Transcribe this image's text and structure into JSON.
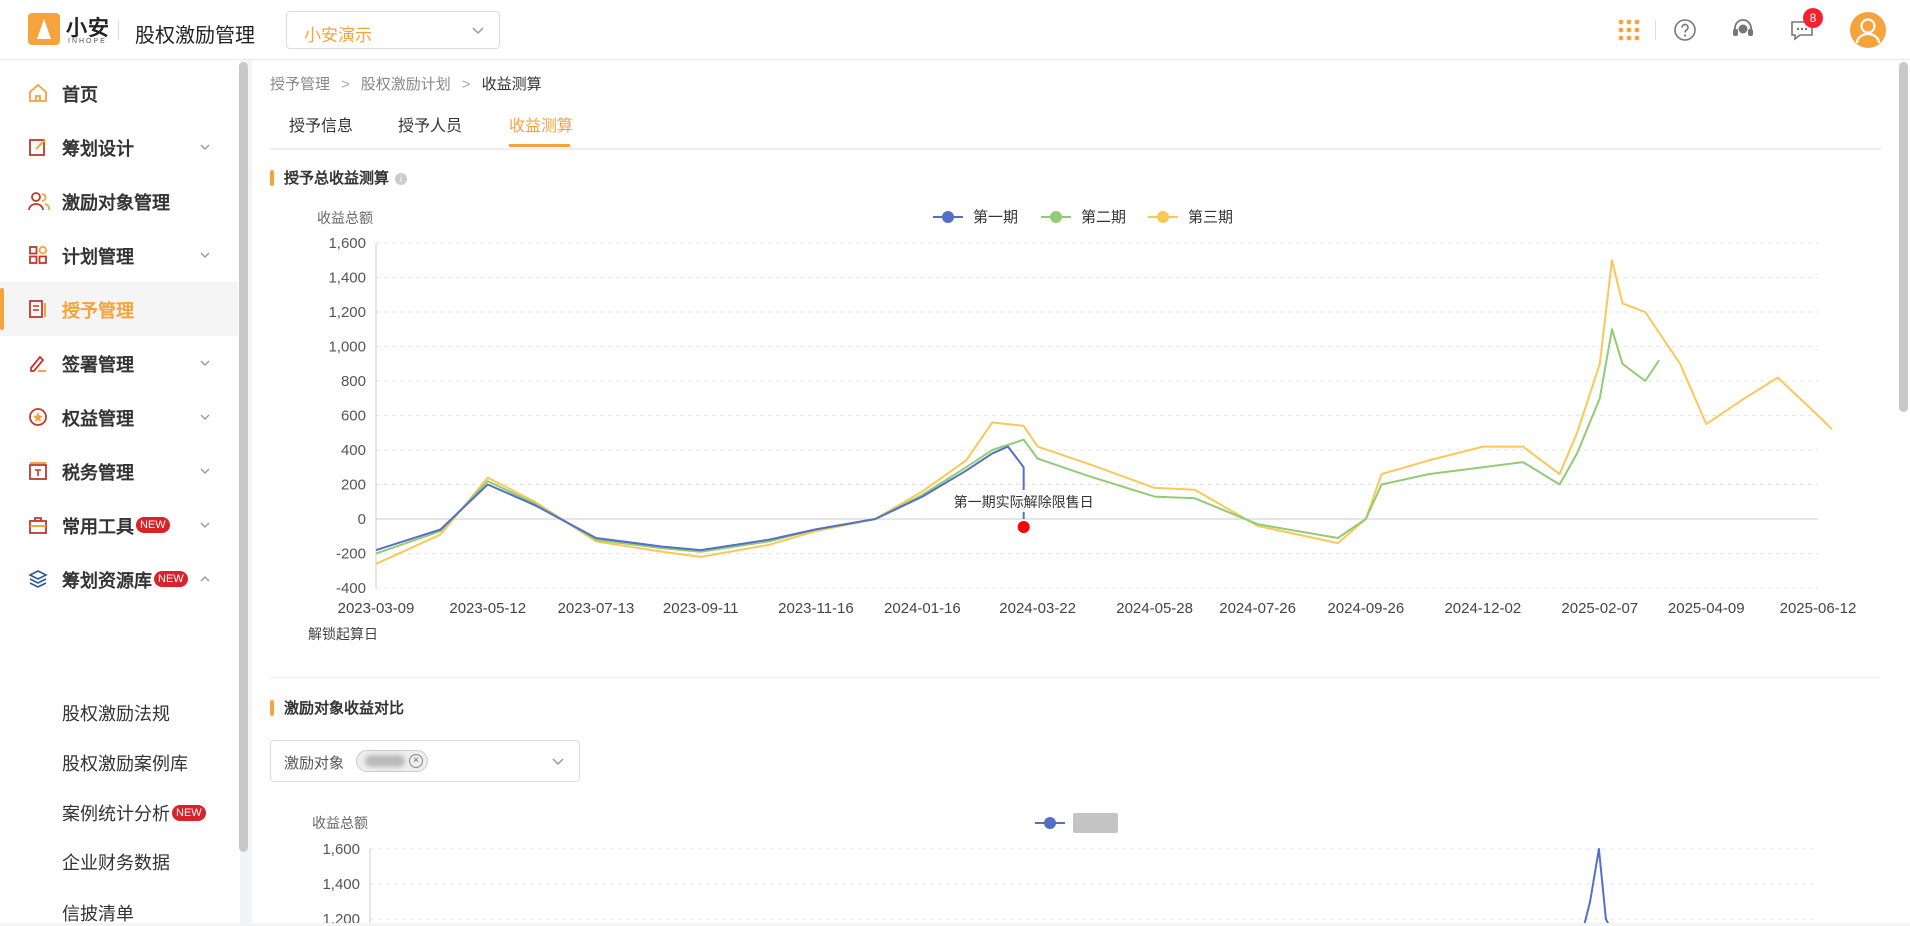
{
  "header": {
    "logo_text": "小安",
    "logo_sub": "INHOPE",
    "app_title": "股权激励管理",
    "company_select": "小安演示",
    "notification_count": "8"
  },
  "sidebar": {
    "items": [
      {
        "label": "首页",
        "icon": "home-icon"
      },
      {
        "label": "筹划设计",
        "icon": "edit-icon"
      },
      {
        "label": "激励对象管理",
        "icon": "users-icon"
      },
      {
        "label": "计划管理",
        "icon": "grid-icon"
      },
      {
        "label": "授予管理",
        "icon": "document-icon",
        "active": true
      },
      {
        "label": "签署管理",
        "icon": "sign-icon"
      },
      {
        "label": "权益管理",
        "icon": "badge-icon"
      },
      {
        "label": "税务管理",
        "icon": "tax-icon"
      },
      {
        "label": "常用工具",
        "icon": "toolbox-icon",
        "badge": "NEW"
      },
      {
        "label": "筹划资源库",
        "icon": "layers-icon",
        "badge": "NEW",
        "expanded": true
      }
    ],
    "sub_items": [
      {
        "label": "股权激励法规"
      },
      {
        "label": "股权激励案例库"
      },
      {
        "label": "案例统计分析",
        "badge": "NEW"
      },
      {
        "label": "企业财务数据"
      },
      {
        "label": "信披清单"
      }
    ]
  },
  "breadcrumb": [
    "授予管理",
    "股权激励计划",
    "收益测算"
  ],
  "tabs": [
    "授予信息",
    "授予人员",
    "收益测算"
  ],
  "active_tab": "收益测算",
  "section1": {
    "title": "授予总收益测算"
  },
  "section2": {
    "title": "激励对象收益对比",
    "filter_label": "激励对象"
  },
  "colors": {
    "accent": "#f7a33c",
    "series1": "#5470c6",
    "series2": "#91cc75",
    "series3": "#fac858",
    "marker": "#ff0000"
  },
  "chart_data": [
    {
      "type": "line",
      "ylabel": "收益总额",
      "xlabel": "解锁起算日",
      "ylim": [
        -400,
        1600
      ],
      "yticks": [
        -400,
        -200,
        0,
        200,
        400,
        600,
        800,
        1000,
        1200,
        1400,
        1600
      ],
      "x_ticks": [
        "2023-03-09",
        "2023-05-12",
        "2023-07-13",
        "2023-09-11",
        "2023-11-16",
        "2024-01-16",
        "2024-03-22",
        "2024-05-28",
        "2024-07-26",
        "2024-09-26",
        "2024-12-02",
        "2025-02-07",
        "2025-04-09",
        "2025-06-12"
      ],
      "legend_position": "top-center",
      "grid": true,
      "annotation": {
        "text": "第一期实际解除限售日",
        "x": "2024-03-14",
        "y": 0
      },
      "series": [
        {
          "name": "第一期",
          "color": "#5470c6",
          "x": [
            "2023-03-09",
            "2023-04-15",
            "2023-05-12",
            "2023-06-08",
            "2023-07-13",
            "2023-08-20",
            "2023-09-11",
            "2023-10-20",
            "2023-11-16",
            "2023-12-20",
            "2024-01-16",
            "2024-02-10",
            "2024-02-25",
            "2024-03-05",
            "2024-03-14"
          ],
          "values": [
            -180,
            -60,
            200,
            80,
            -110,
            -160,
            -180,
            -120,
            -60,
            0,
            130,
            280,
            380,
            420,
            300
          ]
        },
        {
          "name": "第二期",
          "color": "#91cc75",
          "x": [
            "2023-03-09",
            "2023-04-15",
            "2023-05-12",
            "2023-06-08",
            "2023-07-13",
            "2023-08-20",
            "2023-09-11",
            "2023-10-20",
            "2023-11-16",
            "2023-12-20",
            "2024-01-16",
            "2024-02-10",
            "2024-02-25",
            "2024-03-14",
            "2024-03-22",
            "2024-04-20",
            "2024-05-28",
            "2024-06-20",
            "2024-07-26",
            "2024-09-10",
            "2024-09-26",
            "2024-10-05",
            "2024-11-01",
            "2024-12-02",
            "2024-12-25",
            "2025-01-15",
            "2025-01-25",
            "2025-02-07",
            "2025-02-14",
            "2025-02-20",
            "2025-03-05",
            "2025-03-13"
          ],
          "values": [
            -200,
            -70,
            220,
            90,
            -120,
            -170,
            -190,
            -130,
            -60,
            0,
            140,
            300,
            400,
            460,
            350,
            250,
            130,
            120,
            -30,
            -110,
            0,
            200,
            260,
            300,
            330,
            200,
            380,
            700,
            1100,
            900,
            800,
            920
          ]
        },
        {
          "name": "第三期",
          "color": "#fac858",
          "x": [
            "2023-03-09",
            "2023-04-15",
            "2023-05-12",
            "2023-06-08",
            "2023-07-13",
            "2023-08-20",
            "2023-09-11",
            "2023-10-20",
            "2023-11-16",
            "2023-12-20",
            "2024-01-16",
            "2024-02-10",
            "2024-02-25",
            "2024-03-14",
            "2024-03-22",
            "2024-04-20",
            "2024-05-28",
            "2024-06-20",
            "2024-07-26",
            "2024-09-10",
            "2024-09-26",
            "2024-10-05",
            "2024-11-01",
            "2024-12-02",
            "2024-12-25",
            "2025-01-15",
            "2025-01-25",
            "2025-02-07",
            "2025-02-14",
            "2025-02-20",
            "2025-03-05",
            "2025-03-25",
            "2025-04-09",
            "2025-05-01",
            "2025-05-20",
            "2025-06-12",
            "2025-06-20"
          ],
          "values": [
            -260,
            -90,
            240,
            100,
            -130,
            -190,
            -220,
            -150,
            -70,
            0,
            160,
            340,
            560,
            540,
            420,
            320,
            180,
            170,
            -40,
            -140,
            0,
            260,
            340,
            420,
            420,
            260,
            500,
            900,
            1500,
            1250,
            1200,
            900,
            550,
            700,
            820,
            600,
            520
          ]
        }
      ]
    },
    {
      "type": "line",
      "ylabel": "收益总额",
      "ylim": [
        -400,
        1600
      ],
      "yticks_visible": [
        1200,
        1400,
        1600
      ],
      "series": [
        {
          "color": "#5470c6",
          "x": [
            "2025-01-28",
            "2025-02-02",
            "2025-02-07",
            "2025-02-11",
            "2025-02-16",
            "2025-02-21"
          ],
          "values": [
            1100,
            1300,
            1600,
            1200,
            1100,
            1100
          ]
        }
      ]
    }
  ]
}
